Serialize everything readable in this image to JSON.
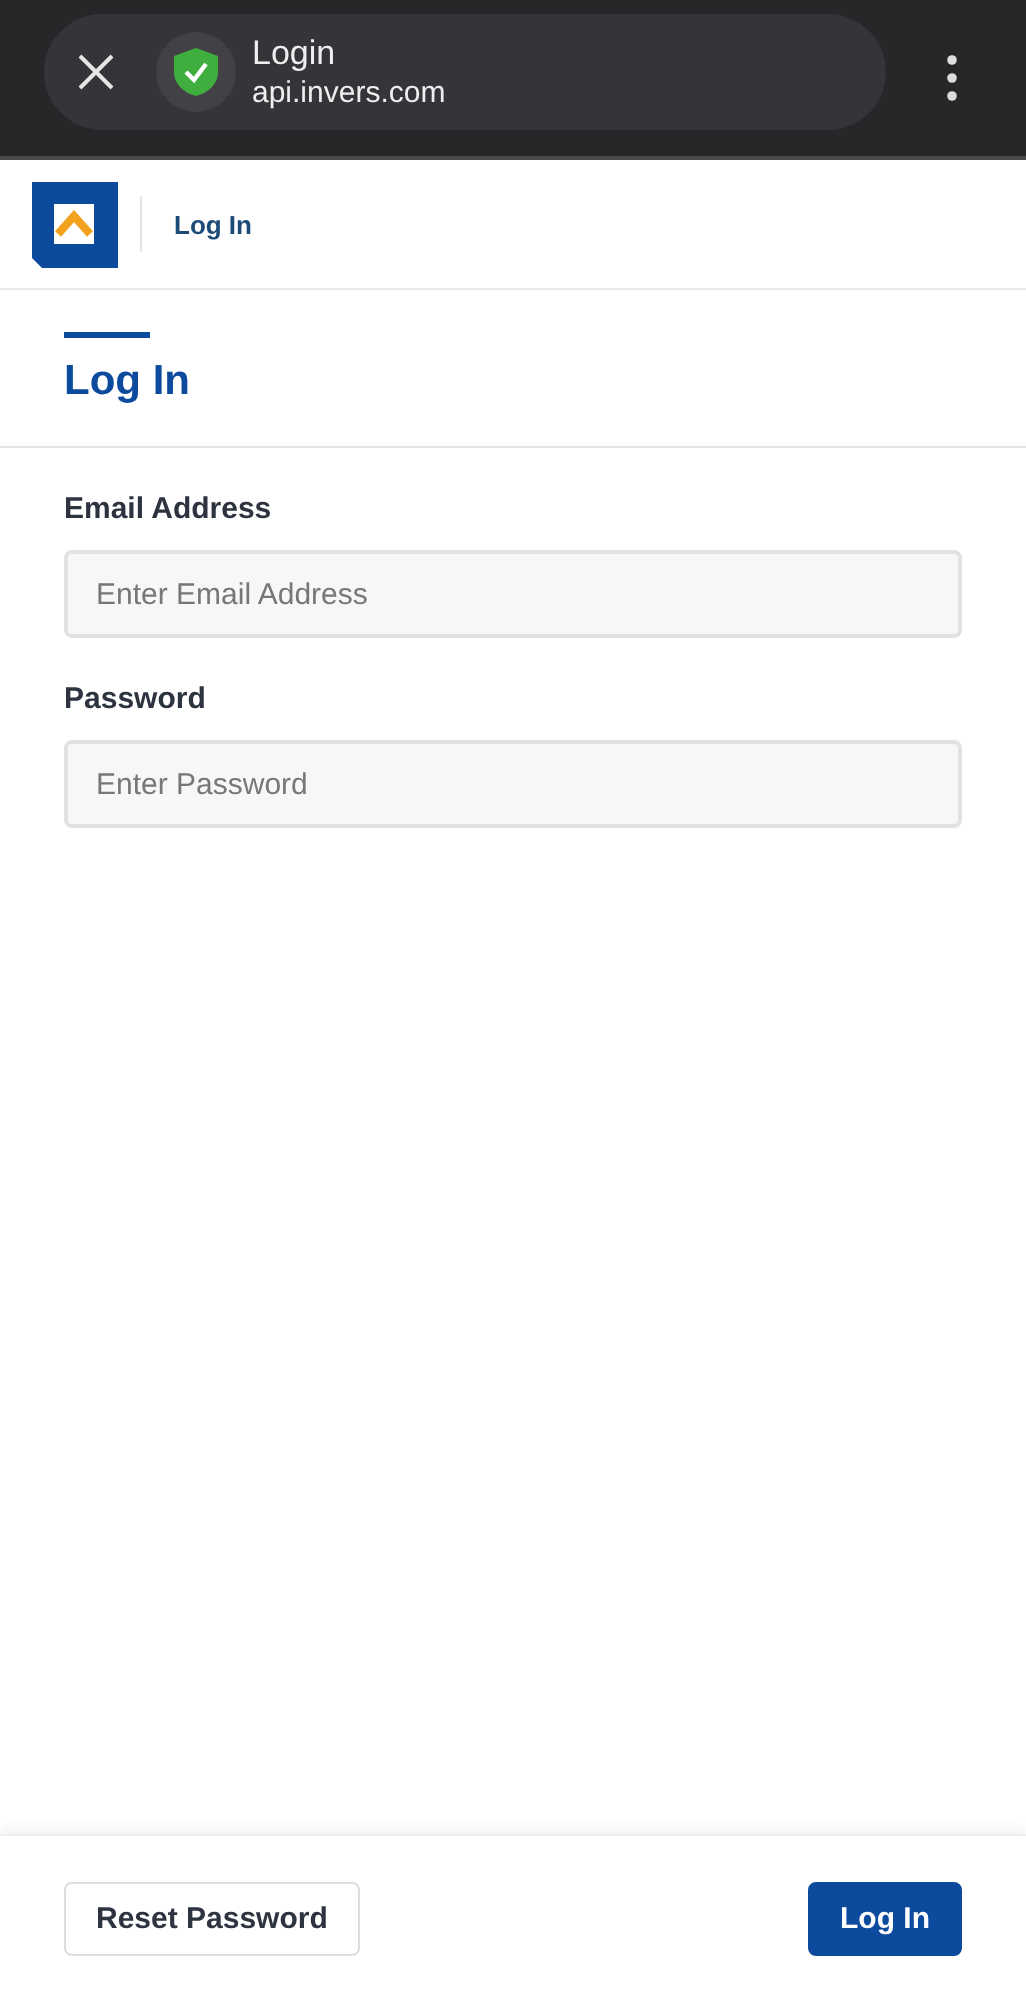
{
  "browser_bar": {
    "title": "Login",
    "url": "api.invers.com"
  },
  "header": {
    "breadcrumb": "Log In"
  },
  "page_title": "Log In",
  "fields": [
    {
      "label": "Email Address",
      "placeholder": "Enter Email Address"
    },
    {
      "label": "Password",
      "placeholder": "Enter Password"
    }
  ],
  "footer": {
    "secondary_button": "Reset Password",
    "primary_button": "Log In"
  }
}
